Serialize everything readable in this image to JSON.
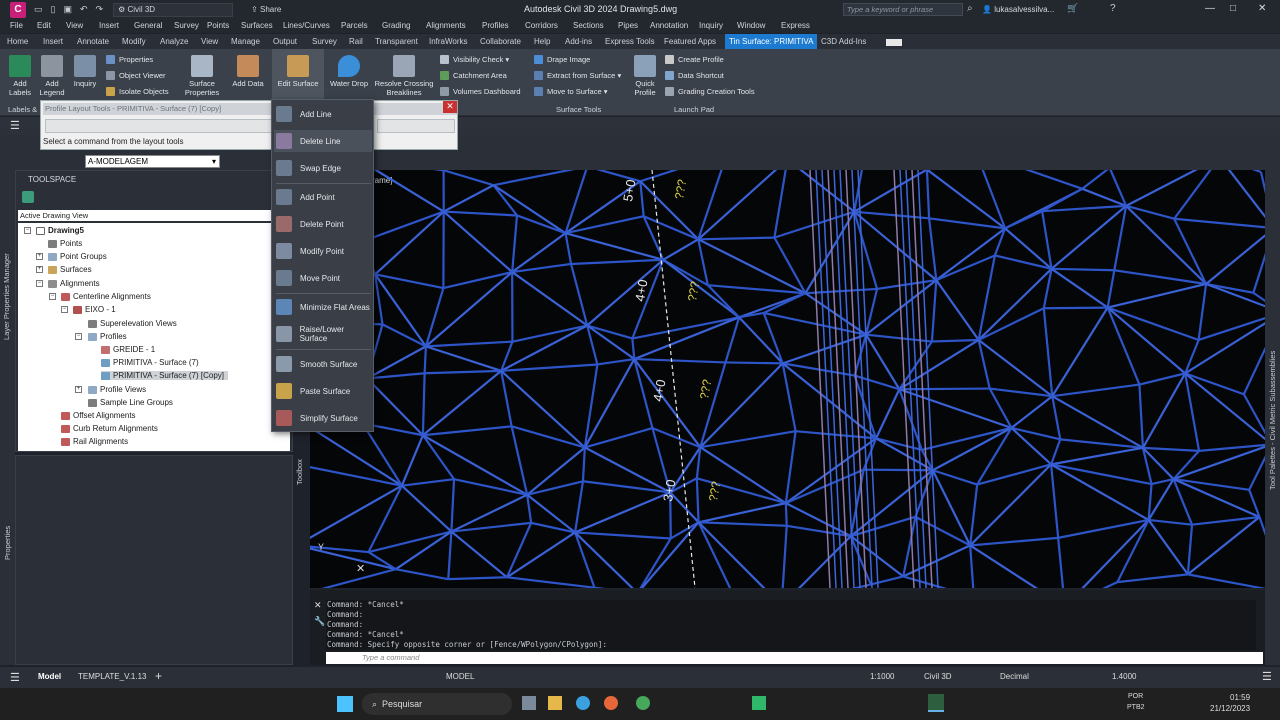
{
  "titlebar": {
    "app_letter": "C",
    "workspace": "Civil 3D",
    "share": "Share",
    "title": "Autodesk Civil 3D 2024   Drawing5.dwg",
    "search_placeholder": "Type a keyword or phrase",
    "user": "lukasalvessilva...",
    "colors": {
      "logo": "#c8207a",
      "accent": "#1c7bd0"
    }
  },
  "menubar": [
    "File",
    "Edit",
    "View",
    "Insert",
    "General",
    "Survey",
    "Points",
    "Surfaces",
    "Lines/Curves",
    "Parcels",
    "Grading",
    "Alignments",
    "Profiles",
    "Corridors",
    "Sections",
    "Pipes",
    "Annotation",
    "Inquiry",
    "Window",
    "Express"
  ],
  "ribbon_tabs": [
    "Home",
    "Insert",
    "Annotate",
    "Modify",
    "Analyze",
    "View",
    "Manage",
    "Output",
    "Survey",
    "Rail",
    "Transparent",
    "InfraWorks",
    "Collaborate",
    "Help",
    "Add-ins",
    "Express Tools",
    "Featured Apps",
    "Tin Surface: PRIMITIVA",
    "C3D Add-Ins"
  ],
  "ribbon": {
    "add_labels": "Add\nLabels",
    "add_legend": "Add\nLegend",
    "inquiry": "Inquiry",
    "properties": "Properties",
    "object_viewer": "Object Viewer",
    "isolate_objects": "Isolate Objects",
    "surface_properties": "Surface\nProperties",
    "add_data": "Add Data",
    "edit_surface": "Edit Surface",
    "water_drop": "Water Drop",
    "resolve_crossing": "Resolve Crossing\nBreaklines",
    "visibility_check": "Visibility Check",
    "catchment_area": "Catchment Area",
    "volumes_dashboard": "Volumes Dashboard",
    "drape_image": "Drape Image",
    "extract_from_surface": "Extract from Surface",
    "move_to_surface": "Move to Surface",
    "surface_tools": "Surface Tools",
    "quick_profile": "Quick\nProfile",
    "create_profile": "Create Profile",
    "data_shortcut": "Data Shortcut",
    "grading_creation_tools": "Grading Creation Tools",
    "launch_pad": "Launch Pad",
    "labels_panel": "Labels &"
  },
  "layer": "A-MODELAGEM",
  "layout_tools": {
    "title": "Profile Layout Tools - PRIMITIVA - Surface (7) [Copy]",
    "status": "Select a command from the layout tools"
  },
  "edit_surface_menu": [
    {
      "label": "Add Line",
      "icon": "add-line-icon"
    },
    {
      "label": "Delete Line",
      "icon": "delete-line-icon"
    },
    {
      "label": "Swap Edge",
      "icon": "swap-edge-icon"
    },
    {
      "label": "Add Point",
      "icon": "add-point-icon"
    },
    {
      "label": "Delete Point",
      "icon": "delete-point-icon"
    },
    {
      "label": "Modify Point",
      "icon": "modify-point-icon"
    },
    {
      "label": "Move Point",
      "icon": "move-point-icon"
    },
    {
      "label": "Minimize Flat Areas",
      "icon": "minimize-flat-icon"
    },
    {
      "label": "Raise/Lower Surface",
      "icon": "raise-lower-icon"
    },
    {
      "label": "Smooth Surface",
      "icon": "smooth-surface-icon"
    },
    {
      "label": "Paste Surface",
      "icon": "paste-surface-icon"
    },
    {
      "label": "Simplify Surface",
      "icon": "simplify-surface-icon"
    }
  ],
  "toolspace": {
    "title": "TOOLSPACE",
    "view": "Active Drawing View",
    "tree": [
      "Drawing5",
      "Points",
      "Point Groups",
      "Surfaces",
      "Alignments",
      "Centerline Alignments",
      "EIXO - 1",
      "Superelevation Views",
      "Profiles",
      "GREIDE - 1",
      "PRIMITIVA - Surface (7)",
      "PRIMITIVA - Surface (7) [Copy]",
      "Profile Views",
      "Sample Line Groups",
      "Offset Alignments",
      "Curb Return Alignments",
      "Rail Alignments"
    ]
  },
  "side_labels": {
    "layer_props": "Layer Properties Manager",
    "properties": "Properties",
    "toolbox": "Toolbox",
    "tool_palettes": "Tool Palettes - Civil Metric Subassemblies"
  },
  "view_label": "rame]",
  "stations": [
    "5+0",
    "4+0",
    "4+0",
    "3+0"
  ],
  "station_marks": [
    "???",
    "???",
    "???",
    "???"
  ],
  "command": {
    "history": [
      "Command: *Cancel*",
      "Command:",
      "Command:",
      "Command: *Cancel*",
      "Command: Specify opposite corner or [Fence/WPolygon/CPolygon]:"
    ],
    "placeholder": "Type a command"
  },
  "layout_tabs": [
    "Model",
    "TEMPLATE_V.1.13"
  ],
  "status": {
    "model": "MODEL",
    "scale": "1:1000",
    "workspace": "Civil 3D",
    "units": "Decimal",
    "value": "1.4000"
  },
  "taskbar": {
    "search": "Pesquisar",
    "lang": "POR",
    "kbd": "PTB2",
    "time": "01:59",
    "date": "21/12/2023"
  }
}
